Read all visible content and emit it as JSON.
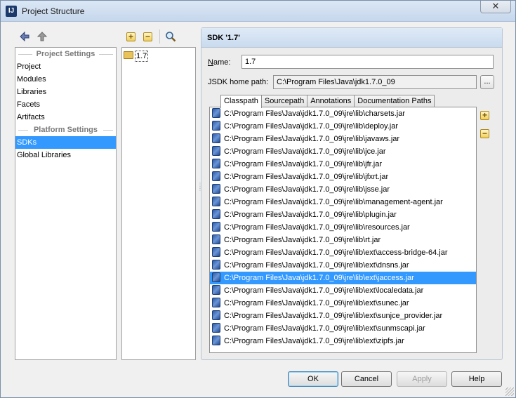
{
  "window": {
    "title": "Project Structure",
    "close_glyph": "✕"
  },
  "left_nav": {
    "project_settings_header": "Project Settings",
    "project_items": [
      "Project",
      "Modules",
      "Libraries",
      "Facets",
      "Artifacts"
    ],
    "platform_settings_header": "Platform Settings",
    "platform_items": [
      "SDKs",
      "Global Libraries"
    ],
    "selected": "SDKs"
  },
  "sdk_list": {
    "items": [
      "1.7"
    ]
  },
  "detail": {
    "header": "SDK '1.7'",
    "name_label_mnemonic": "N",
    "name_label_rest": "ame:",
    "name_value": "1.7",
    "home_path_label": "JSDK home path:",
    "home_path_value": "C:\\Program Files\\Java\\jdk1.7.0_09",
    "browse_label": "...",
    "tabs": [
      "Classpath",
      "Sourcepath",
      "Annotations",
      "Documentation Paths"
    ],
    "active_tab": "Classpath",
    "classpath": [
      "C:\\Program Files\\Java\\jdk1.7.0_09\\jre\\lib\\charsets.jar",
      "C:\\Program Files\\Java\\jdk1.7.0_09\\jre\\lib\\deploy.jar",
      "C:\\Program Files\\Java\\jdk1.7.0_09\\jre\\lib\\javaws.jar",
      "C:\\Program Files\\Java\\jdk1.7.0_09\\jre\\lib\\jce.jar",
      "C:\\Program Files\\Java\\jdk1.7.0_09\\jre\\lib\\jfr.jar",
      "C:\\Program Files\\Java\\jdk1.7.0_09\\jre\\lib\\jfxrt.jar",
      "C:\\Program Files\\Java\\jdk1.7.0_09\\jre\\lib\\jsse.jar",
      "C:\\Program Files\\Java\\jdk1.7.0_09\\jre\\lib\\management-agent.jar",
      "C:\\Program Files\\Java\\jdk1.7.0_09\\jre\\lib\\plugin.jar",
      "C:\\Program Files\\Java\\jdk1.7.0_09\\jre\\lib\\resources.jar",
      "C:\\Program Files\\Java\\jdk1.7.0_09\\jre\\lib\\rt.jar",
      "C:\\Program Files\\Java\\jdk1.7.0_09\\jre\\lib\\ext\\access-bridge-64.jar",
      "C:\\Program Files\\Java\\jdk1.7.0_09\\jre\\lib\\ext\\dnsns.jar",
      "C:\\Program Files\\Java\\jdk1.7.0_09\\jre\\lib\\ext\\jaccess.jar",
      "C:\\Program Files\\Java\\jdk1.7.0_09\\jre\\lib\\ext\\localedata.jar",
      "C:\\Program Files\\Java\\jdk1.7.0_09\\jre\\lib\\ext\\sunec.jar",
      "C:\\Program Files\\Java\\jdk1.7.0_09\\jre\\lib\\ext\\sunjce_provider.jar",
      "C:\\Program Files\\Java\\jdk1.7.0_09\\jre\\lib\\ext\\sunmscapi.jar",
      "C:\\Program Files\\Java\\jdk1.7.0_09\\jre\\lib\\ext\\zipfs.jar"
    ],
    "selected_classpath_index": 13
  },
  "buttons": {
    "ok": "OK",
    "cancel": "Cancel",
    "apply": "Apply",
    "help": "Help"
  },
  "colors": {
    "selection": "#3399ff",
    "header_gradient_top": "#dfeaf6"
  }
}
